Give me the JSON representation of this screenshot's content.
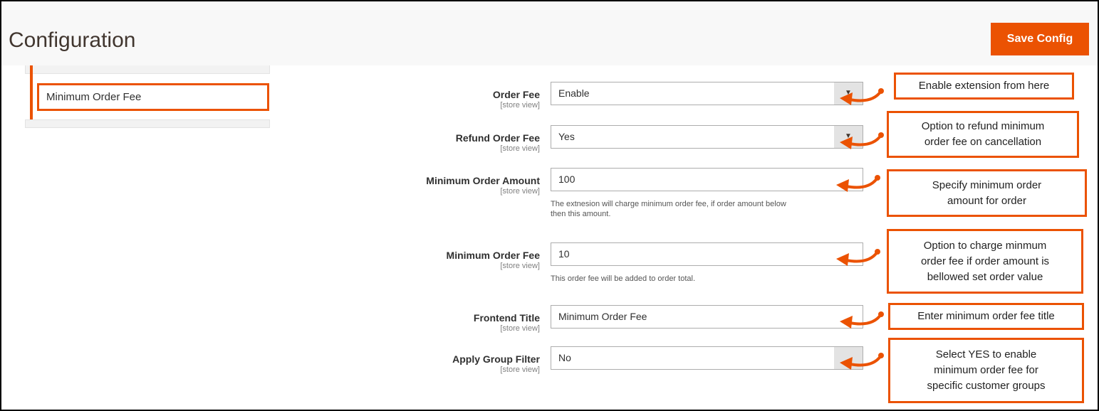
{
  "header": {
    "title": "Configuration",
    "save_label": "Save Config"
  },
  "sidebar": {
    "items": [
      {
        "label": "Minimum Order Fee",
        "active": true
      }
    ]
  },
  "form": {
    "fields": [
      {
        "label": "Order Fee",
        "scope": "[store view]",
        "type": "select",
        "value": "Enable",
        "note": ""
      },
      {
        "label": "Refund Order Fee",
        "scope": "[store view]",
        "type": "select",
        "value": "Yes",
        "note": ""
      },
      {
        "label": "Minimum Order Amount",
        "scope": "[store view]",
        "type": "input",
        "value": "100",
        "note_line1": "The extnesion will charge minimum order fee, if order amount below",
        "note_line2": "then this amount."
      },
      {
        "label": "Minimum Order Fee",
        "scope": "[store view]",
        "type": "input",
        "value": "10",
        "note_line1": "This order fee will be added to order total."
      },
      {
        "label": "Frontend Title",
        "scope": "[store view]",
        "type": "input",
        "value": "Minimum Order Fee",
        "note": ""
      },
      {
        "label": "Apply Group Filter",
        "scope": "[store view]",
        "type": "select",
        "value": "No",
        "note": ""
      }
    ]
  },
  "callouts": [
    {
      "line1": "Enable extension from here"
    },
    {
      "line1": "Option to refund minimum",
      "line2": "order fee on cancellation"
    },
    {
      "line1": "Specify minimum order",
      "line2": "amount for order"
    },
    {
      "line1": "Option to charge minmum",
      "line2": "order fee if order amount is",
      "line3": "bellowed set order value"
    },
    {
      "line1": "Enter minimum order fee title"
    },
    {
      "line1": "Select YES to enable",
      "line2": "minimum order fee for",
      "line3": "specific customer groups"
    }
  ],
  "colors": {
    "accent": "#eb5202",
    "header_bg": "#f8f8f8"
  },
  "icons": {
    "select_arrow": "chevron-down-icon",
    "callout_pointer": "curved-arrow-icon"
  }
}
